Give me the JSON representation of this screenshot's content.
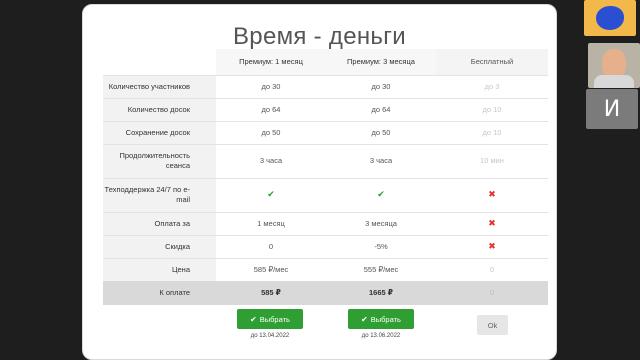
{
  "slide": {
    "title": "Время - деньги",
    "headers": {
      "premium_1": "Премиум: 1 месяц",
      "premium_3": "Премиум: 3 месяца",
      "free": "Бесплатный"
    },
    "rows": [
      {
        "label": "Количество участников",
        "premium_1": "до 30",
        "premium_3": "до 30",
        "free": "до 3"
      },
      {
        "label": "Количество досок",
        "premium_1": "до 64",
        "premium_3": "до 64",
        "free": "до 10"
      },
      {
        "label": "Сохранение досок",
        "premium_1": "до 50",
        "premium_3": "до 50",
        "free": "до 10"
      },
      {
        "label": "Продолжительность сеанса",
        "premium_1": "3 часа",
        "premium_3": "3 часа",
        "free": "10 мин"
      },
      {
        "label": "Техподдержка 24/7 по e-mail",
        "premium_1": "✔",
        "premium_3": "✔",
        "free": "✖"
      },
      {
        "label": "Оплата за",
        "premium_1": "1 месяц",
        "premium_3": "3 месяца",
        "free": "✖"
      },
      {
        "label": "Скидка",
        "premium_1": "0",
        "premium_3": "-5%",
        "free": "✖"
      },
      {
        "label": "Цена",
        "premium_1": "585 ₽/мес",
        "premium_3": "555 ₽/мес",
        "free": "0"
      }
    ],
    "total": {
      "label": "К оплате",
      "premium_1": "585 ₽",
      "premium_3": "1665 ₽",
      "free": "0"
    },
    "buttons": {
      "select_1": "Выбрать",
      "select_3": "Выбрать",
      "ok": "Ok",
      "date_1": "до 13.04.2022",
      "date_3": "до 13.06.2022"
    }
  },
  "participants": {
    "initial": "И"
  },
  "colors": {
    "accent_green": "#2f9e33",
    "cross_red": "#e2352b",
    "background": "#1e1e1e"
  }
}
